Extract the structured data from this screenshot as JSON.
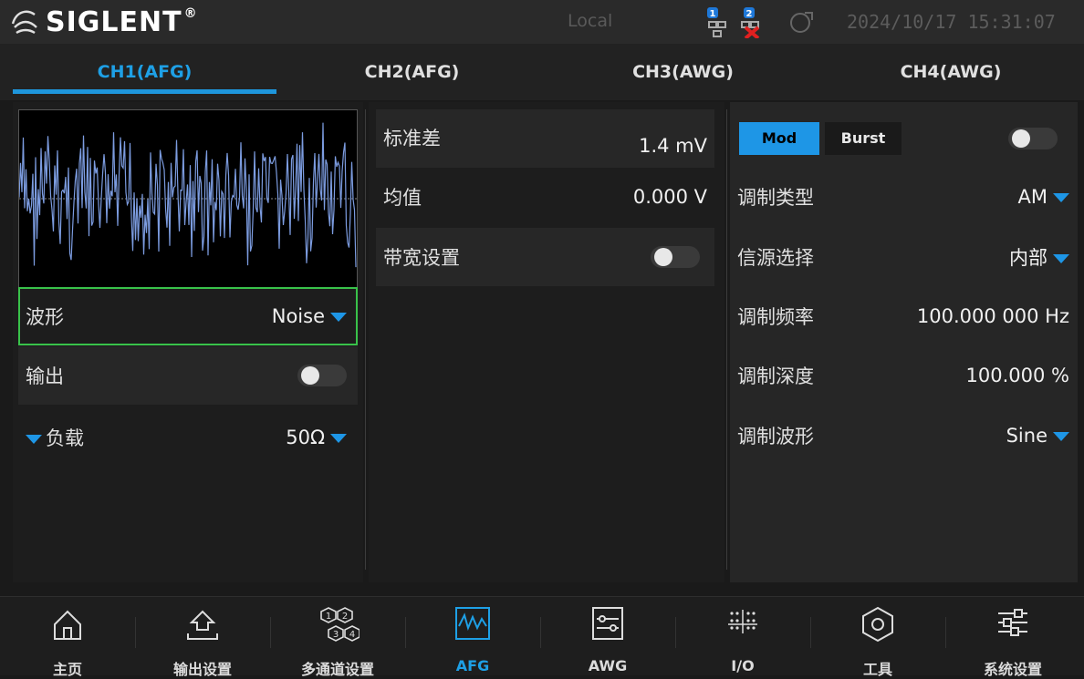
{
  "status_bar": {
    "brand": "SIGLENT",
    "brand_mark": "®",
    "mode": "Local",
    "network_badges": [
      "1",
      "2"
    ],
    "datetime": "2024/10/17  15:31:07"
  },
  "tabs": [
    {
      "label": "CH1(AFG)",
      "active": true
    },
    {
      "label": "CH2(AFG)",
      "active": false
    },
    {
      "label": "CH3(AWG)",
      "active": false
    },
    {
      "label": "CH4(AWG)",
      "active": false
    }
  ],
  "left_panel": {
    "waveform": {
      "label": "波形",
      "value": "Noise"
    },
    "output": {
      "label": "输出",
      "enabled": false
    },
    "load": {
      "label": "负载",
      "value": "50Ω"
    }
  },
  "middle_panel": {
    "std_dev": {
      "label": "标准差",
      "value": "1.4 mV"
    },
    "mean": {
      "label": "均值",
      "value": "0.000 V"
    },
    "bandwidth": {
      "label": "带宽设置",
      "enabled": false
    }
  },
  "right_panel": {
    "mod_button": "Mod",
    "burst_button": "Burst",
    "mod_enabled": false,
    "mod_type": {
      "label": "调制类型",
      "value": "AM"
    },
    "source": {
      "label": "信源选择",
      "value": "内部"
    },
    "mod_freq": {
      "label": "调制频率",
      "value": "100.000 000 Hz"
    },
    "mod_depth": {
      "label": "调制深度",
      "value": "100.000 %"
    },
    "mod_wave": {
      "label": "调制波形",
      "value": "Sine"
    }
  },
  "nav": [
    {
      "label": "主页",
      "icon": "home-icon"
    },
    {
      "label": "输出设置",
      "icon": "output-settings-icon"
    },
    {
      "label": "多通道设置",
      "icon": "multichannel-icon"
    },
    {
      "label": "AFG",
      "icon": "afg-wave-icon",
      "active": true
    },
    {
      "label": "AWG",
      "icon": "awg-icon"
    },
    {
      "label": "I/O",
      "icon": "io-icon"
    },
    {
      "label": "工具",
      "icon": "tools-hexagon-icon"
    },
    {
      "label": "系统设置",
      "icon": "system-settings-icon"
    }
  ],
  "colors": {
    "accent": "#1e96e6",
    "selection_border": "#39c24a",
    "waveform_trace": "#7c9ce0",
    "error_x": "#e02020"
  }
}
